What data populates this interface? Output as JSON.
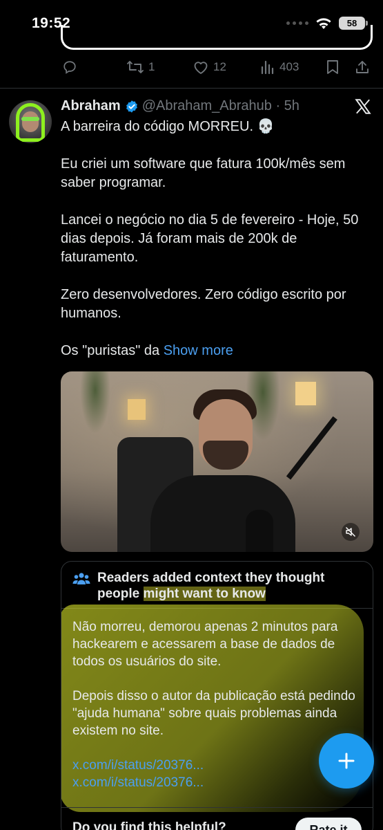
{
  "status_bar": {
    "time": "19:52",
    "battery": "58"
  },
  "previous_tweet": {
    "actions": {
      "reply_icon": "reply-icon",
      "retweet_count": "1",
      "like_count": "12",
      "views_count": "403"
    }
  },
  "tweet": {
    "author_name": "Abraham",
    "handle_time": "@Abraham_Abrahub · 5h",
    "paragraphs": [
      "A barreira do código MORREU. 💀",
      "Eu criei um software que fatura 100k/mês sem saber programar.",
      "Lancei o negócio no dia 5 de fevereiro - Hoje, 50 dias depois. Já foram mais de 200k de faturamento.",
      "Zero desenvolvedores. Zero código escrito por humanos."
    ],
    "last_line_prefix": "Os \"puristas\" da ",
    "show_more": "Show more"
  },
  "community_note": {
    "title_part1": "Readers added context they thought people ",
    "title_part2": "might want to know",
    "paragraphs": [
      "Não morreu, demorou apenas 2 minutos para hackearem e acessarem a base de dados de todos os usuários do site.",
      "Depois disso o autor da publicação está pedindo \"ajuda humana\" sobre quais problemas ainda existem no site."
    ],
    "links": [
      "x.com/i/status/20376...",
      "x.com/i/status/20376..."
    ],
    "footer_question": "Do you find this helpful?",
    "rate_button": "Rate it"
  },
  "colors": {
    "background": "#000000",
    "link": "#4b9ff0",
    "verified": "#1d9bf0",
    "fab": "#1d9bf0",
    "muted": "#71767b"
  }
}
